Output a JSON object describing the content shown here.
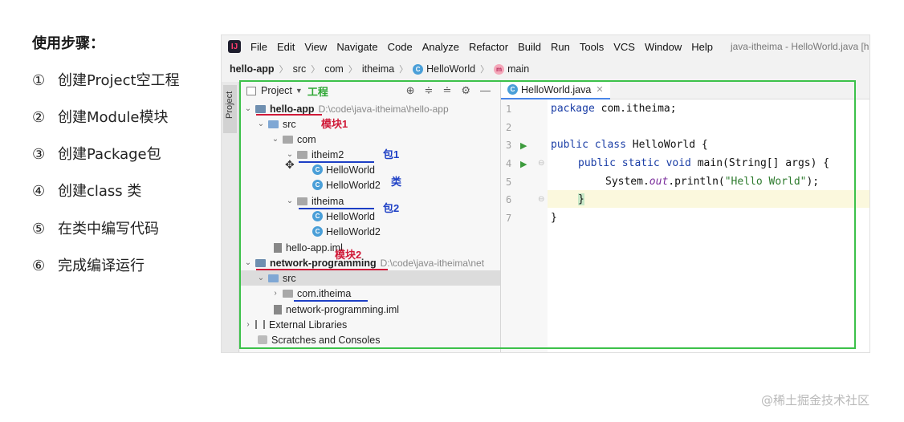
{
  "steps": {
    "title": "使用步骤：",
    "items": [
      {
        "num": "①",
        "text": "创建Project空工程"
      },
      {
        "num": "②",
        "text": "创建Module模块"
      },
      {
        "num": "③",
        "text": "创建Package包"
      },
      {
        "num": "④",
        "text": "创建class 类"
      },
      {
        "num": "⑤",
        "text": "在类中编写代码"
      },
      {
        "num": "⑥",
        "text": "完成编译运行"
      }
    ]
  },
  "ide": {
    "menu": [
      "File",
      "Edit",
      "View",
      "Navigate",
      "Code",
      "Analyze",
      "Refactor",
      "Build",
      "Run",
      "Tools",
      "VCS",
      "Window",
      "Help"
    ],
    "window_title": "java-itheima - HelloWorld.java [h",
    "breadcrumb": [
      "hello-app",
      "src",
      "com",
      "itheima",
      "HelloWorld",
      "main"
    ],
    "side_tab": "Project",
    "project_panel": {
      "label": "Project",
      "annotation": "工程",
      "tree": [
        {
          "label": "hello-app",
          "path": "D:\\code\\java-itheima\\hello-app",
          "annotation": "模块1"
        },
        {
          "label": "src"
        },
        {
          "label": "com"
        },
        {
          "label": "itheim2",
          "annotation": "包1"
        },
        {
          "label": "HelloWorld"
        },
        {
          "label": "HelloWorld2",
          "annotation": "类"
        },
        {
          "label": "itheima",
          "annotation": "包2"
        },
        {
          "label": "HelloWorld"
        },
        {
          "label": "HelloWorld2"
        },
        {
          "label": "hello-app.iml"
        },
        {
          "label": "network-programming",
          "path": "D:\\code\\java-itheima\\net",
          "annotation": "模块2"
        },
        {
          "label": "src"
        },
        {
          "label": "com.itheima"
        },
        {
          "label": "network-programming.iml"
        },
        {
          "label": "External Libraries"
        },
        {
          "label": "Scratches and Consoles"
        }
      ]
    },
    "editor": {
      "tab": "HelloWorld.java",
      "line_numbers": [
        "1",
        "2",
        "3",
        "4",
        "5",
        "6",
        "7"
      ],
      "code": {
        "l1_kw": "package",
        "l1_rest": " com.itheima;",
        "l3_kw": "public class",
        "l3_rest": " HelloWorld {",
        "l4_kw": "public static void",
        "l4_rest": " main(String[] args) {",
        "l5_a": "System.",
        "l5_it": "out",
        "l5_b": ".println(",
        "l5_str": "\"Hello World\"",
        "l5_c": ");",
        "l6": "}",
        "l7": "}"
      }
    }
  },
  "watermark": "@稀土掘金技术社区",
  "colors": {
    "frame": "#3cc14a",
    "annot_red": "#d01a38",
    "annot_blue": "#1d3fc5"
  }
}
